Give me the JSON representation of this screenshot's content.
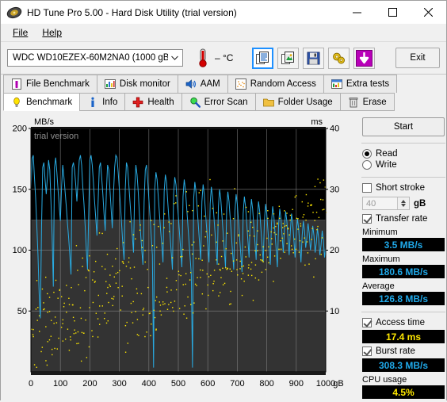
{
  "window": {
    "title": "HD Tune Pro 5.00 - Hard Disk Utility (trial version)",
    "icon": "hard-disk-icon",
    "minimize": "—",
    "maximize": "☐",
    "close": "✕"
  },
  "menu": {
    "items": [
      {
        "label": "File"
      },
      {
        "label": "Help"
      }
    ]
  },
  "toolbar": {
    "drive": "WDC WD10EZEX-60M2NA0 (1000 gB)",
    "chevron": "⌄",
    "temperature": "– °C",
    "buttons": [
      {
        "name": "copy-text-button",
        "icon": "copy-text-icon",
        "selected": true
      },
      {
        "name": "copy-image-button",
        "icon": "copy-image-icon",
        "selected": false
      },
      {
        "name": "save-button",
        "icon": "floppy-save-icon",
        "selected": false
      },
      {
        "name": "options-button",
        "icon": "gears-icon",
        "selected": false
      },
      {
        "name": "download-button",
        "icon": "download-arrow-icon",
        "selected": false
      }
    ],
    "exit_label": "Exit"
  },
  "tabs": {
    "row1": [
      {
        "label": "File Benchmark",
        "icon": "file-benchmark-icon",
        "active": false
      },
      {
        "label": "Disk monitor",
        "icon": "disk-monitor-icon",
        "active": false
      },
      {
        "label": "AAM",
        "icon": "speaker-icon",
        "active": false
      },
      {
        "label": "Random Access",
        "icon": "random-access-icon",
        "active": false
      },
      {
        "label": "Extra tests",
        "icon": "extra-tests-icon",
        "active": false
      }
    ],
    "row2": [
      {
        "label": "Benchmark",
        "icon": "lightbulb-icon",
        "active": true
      },
      {
        "label": "Info",
        "icon": "info-icon",
        "active": false
      },
      {
        "label": "Health",
        "icon": "red-cross-icon",
        "active": false
      },
      {
        "label": "Error Scan",
        "icon": "magnifier-icon",
        "active": false
      },
      {
        "label": "Folder Usage",
        "icon": "folder-icon",
        "active": false
      },
      {
        "label": "Erase",
        "icon": "trash-icon",
        "active": false
      }
    ]
  },
  "panel": {
    "start_label": "Start",
    "mode": {
      "read_label": "Read",
      "write_label": "Write",
      "selected": "Read"
    },
    "short_stroke": {
      "label": "Short stroke",
      "checked": false,
      "value": "40",
      "unit": "gB"
    },
    "transfer_rate": {
      "label": "Transfer rate",
      "checked": true
    },
    "minimum": {
      "label": "Minimum",
      "value": "3.5 MB/s"
    },
    "maximum": {
      "label": "Maximum",
      "value": "180.6 MB/s"
    },
    "average": {
      "label": "Average",
      "value": "126.8 MB/s"
    },
    "access_time": {
      "label": "Access time",
      "checked": true,
      "value": "17.4 ms"
    },
    "burst_rate": {
      "label": "Burst rate",
      "checked": true,
      "value": "308.3 MB/s"
    },
    "cpu_usage": {
      "label": "CPU usage",
      "value": "4.5%"
    }
  },
  "chart_data": {
    "type": "line",
    "title": "",
    "watermark": "trial version",
    "xlabel": "gB",
    "ylabel": "MB/s",
    "y2label": "ms",
    "xlim": [
      0,
      1000
    ],
    "ylim": [
      0,
      200
    ],
    "y2lim": [
      0,
      40
    ],
    "xticks": [
      0,
      100,
      200,
      300,
      400,
      500,
      600,
      700,
      800,
      900,
      1000
    ],
    "yticks": [
      50,
      100,
      150,
      200
    ],
    "y2ticks": [
      10,
      20,
      30,
      40
    ],
    "xtick_labels": [
      "0",
      "100",
      "200",
      "300",
      "400",
      "500",
      "600",
      "700",
      "800",
      "900",
      "1000"
    ],
    "ytick_labels": [
      "50",
      "100",
      "150",
      "200"
    ],
    "y2tick_labels": [
      "10",
      "20",
      "30",
      "40"
    ],
    "x_unit_suffix": "gB",
    "grid": true,
    "legend": "none",
    "colors": {
      "transfer_rate": "#29ABE2",
      "access_time": "#FFE800",
      "plot_bg_top": "#000000",
      "plot_bg_bottom": "#333333",
      "grid": "#8a8a8a"
    },
    "band_split_mbs": 125,
    "series": [
      {
        "name": "Transfer rate",
        "unit": "MB/s",
        "axis": "left",
        "color": "#29ABE2",
        "x": [
          0,
          4,
          8,
          12,
          16,
          20,
          24,
          28,
          32,
          36,
          40,
          44,
          48,
          52,
          56,
          60,
          64,
          68,
          72,
          76,
          80,
          84,
          88,
          92,
          96,
          100,
          104,
          108,
          112,
          116,
          120,
          124,
          128,
          132,
          136,
          140,
          144,
          148,
          152,
          156,
          160,
          164,
          168,
          172,
          176,
          180,
          184,
          188,
          192,
          196,
          200,
          204,
          208,
          212,
          216,
          220,
          224,
          228,
          232,
          236,
          240,
          244,
          248,
          252,
          256,
          260,
          264,
          268,
          272,
          276,
          280,
          284,
          288,
          292,
          296,
          300,
          304,
          308,
          312,
          316,
          320,
          324,
          328,
          332,
          336,
          340,
          344,
          348,
          352,
          356,
          360,
          364,
          368,
          372,
          376,
          380,
          384,
          388,
          392,
          396,
          400,
          404,
          408,
          412,
          416,
          420,
          424,
          428,
          432,
          436,
          440,
          444,
          448,
          452,
          456,
          460,
          464,
          468,
          472,
          476,
          480,
          484,
          488,
          492,
          496,
          500,
          504,
          508,
          512,
          516,
          520,
          524,
          528,
          532,
          536,
          540,
          544,
          548,
          552,
          556,
          560,
          564,
          568,
          572,
          576,
          580,
          584,
          588,
          592,
          596,
          600,
          604,
          608,
          612,
          616,
          620,
          624,
          628,
          632,
          636,
          640,
          644,
          648,
          652,
          656,
          660,
          664,
          668,
          672,
          676,
          680,
          684,
          688,
          692,
          696,
          700,
          704,
          708,
          712,
          716,
          720,
          724,
          728,
          732,
          736,
          740,
          744,
          748,
          752,
          756,
          760,
          764,
          768,
          772,
          776,
          780,
          784,
          788,
          792,
          796,
          800,
          804,
          808,
          812,
          816,
          820,
          824,
          828,
          832,
          836,
          840,
          844,
          848,
          852,
          856,
          860,
          864,
          868,
          872,
          876,
          880,
          884,
          888,
          892,
          896,
          900,
          904,
          908,
          912,
          916,
          920,
          924,
          928,
          932,
          936,
          940,
          944,
          948,
          952,
          956,
          960,
          964,
          968,
          972,
          976,
          980,
          984,
          988,
          992,
          996,
          1000
        ],
        "y": [
          150,
          175,
          178,
          160,
          143,
          120,
          96,
          64,
          44,
          118,
          168,
          172,
          158,
          146,
          160,
          174,
          166,
          140,
          112,
          70,
          168,
          176,
          164,
          150,
          136,
          124,
          152,
          170,
          160,
          148,
          136,
          122,
          110,
          96,
          80,
          168,
          172,
          166,
          154,
          140,
          158,
          174,
          178,
          170,
          152,
          138,
          120,
          100,
          84,
          130,
          174,
          178,
          170,
          156,
          140,
          126,
          112,
          140,
          168,
          172,
          160,
          146,
          130,
          116,
          148,
          170,
          166,
          150,
          134,
          118,
          146,
          168,
          178,
          176,
          164,
          150,
          136,
          120,
          104,
          92,
          150,
          172,
          168,
          154,
          140,
          126,
          112,
          98,
          150,
          170,
          162,
          148,
          130,
          114,
          100,
          88,
          140,
          166,
          170,
          158,
          142,
          128,
          112,
          96,
          3.5,
          150,
          164,
          158,
          144,
          130,
          116,
          104,
          90,
          148,
          162,
          156,
          140,
          126,
          112,
          98,
          84,
          146,
          160,
          154,
          140,
          128,
          114,
          100,
          86,
          144,
          158,
          150,
          136,
          122,
          108,
          94,
          80,
          3.5,
          142,
          156,
          148,
          134,
          120,
          106,
          92,
          140,
          154,
          146,
          132,
          118,
          104,
          90,
          138,
          152,
          144,
          130,
          116,
          102,
          88,
          136,
          150,
          142,
          128,
          114,
          100,
          86,
          134,
          148,
          140,
          126,
          112,
          98,
          84,
          132,
          146,
          138,
          124,
          110,
          96,
          82,
          130,
          144,
          136,
          122,
          108,
          94,
          128,
          142,
          134,
          120,
          106,
          92,
          126,
          140,
          132,
          118,
          104,
          90,
          124,
          138,
          130,
          116,
          102,
          88,
          122,
          136,
          128,
          114,
          100,
          86,
          120,
          134,
          126,
          112,
          98,
          118,
          132,
          124,
          110,
          96,
          116,
          130,
          122,
          108,
          94,
          114,
          126,
          118,
          104,
          90,
          112,
          124,
          116,
          102,
          110,
          122,
          114,
          100,
          108,
          120,
          112,
          98,
          106,
          118,
          110,
          96,
          104,
          116,
          108,
          94,
          102,
          114,
          106,
          92,
          100,
          112,
          104,
          90,
          98,
          110,
          102,
          88,
          96,
          108,
          100,
          86,
          94,
          106,
          98,
          84,
          92,
          104,
          96,
          82,
          90,
          102,
          94,
          80
        ]
      },
      {
        "name": "Access time",
        "unit": "ms",
        "axis": "right",
        "style": "scatter",
        "color": "#FFE800",
        "x": [
          5,
          12,
          18,
          25,
          31,
          38,
          45,
          52,
          58,
          64,
          70,
          77,
          84,
          90,
          97,
          104,
          110,
          116,
          123,
          130,
          136,
          143,
          150,
          156,
          163,
          170,
          176,
          183,
          190,
          196,
          203,
          210,
          216,
          223,
          230,
          236,
          243,
          250,
          256,
          263,
          270,
          276,
          283,
          290,
          296,
          303,
          310,
          316,
          323,
          330,
          336,
          343,
          350,
          356,
          363,
          370,
          376,
          383,
          390,
          396,
          403,
          410,
          416,
          423,
          430,
          436,
          443,
          450,
          456,
          463,
          470,
          476,
          483,
          490,
          496,
          503,
          510,
          516,
          523,
          530,
          536,
          543,
          550,
          556,
          563,
          570,
          576,
          583,
          590,
          596,
          603,
          610,
          616,
          623,
          630,
          636,
          643,
          650,
          656,
          663,
          670,
          676,
          683,
          690,
          696,
          703,
          710,
          716,
          723,
          730,
          736,
          743,
          750,
          756,
          763,
          770,
          776,
          783,
          790,
          796,
          803,
          810,
          816,
          823,
          830,
          836,
          843,
          850,
          856,
          863,
          870,
          876,
          883,
          890,
          896,
          903,
          910,
          916,
          923,
          930,
          936,
          943,
          950,
          956,
          963,
          970,
          976,
          983,
          990,
          996
        ],
        "y": [
          9.2,
          10.1,
          11.3,
          8.8,
          12.4,
          10.6,
          13.2,
          11.0,
          9.6,
          14.1,
          12.0,
          10.8,
          13.6,
          15.2,
          11.6,
          12.8,
          14.4,
          10.4,
          16.0,
          13.0,
          11.8,
          15.6,
          12.6,
          17.1,
          13.8,
          11.4,
          16.4,
          14.8,
          12.2,
          18.0,
          15.0,
          13.4,
          17.6,
          14.0,
          12.9,
          19.2,
          16.2,
          13.6,
          15.8,
          18.4,
          14.6,
          12.4,
          20.1,
          16.8,
          14.2,
          17.2,
          19.6,
          15.4,
          13.1,
          21.0,
          17.4,
          14.9,
          18.8,
          16.0,
          13.7,
          22.4,
          18.2,
          15.6,
          19.4,
          16.6,
          14.3,
          23.1,
          18.9,
          16.1,
          20.2,
          17.0,
          14.8,
          24.0,
          19.6,
          16.8,
          21.1,
          17.6,
          15.2,
          25.2,
          20.4,
          17.4,
          21.8,
          18.2,
          15.8,
          26.1,
          21.0,
          18.0,
          22.6,
          18.8,
          16.2,
          27.0,
          21.6,
          18.6,
          23.2,
          19.4,
          16.8,
          28.2,
          22.2,
          19.2,
          24.0,
          20.0,
          17.2,
          29.0,
          22.8,
          19.8,
          24.6,
          20.6,
          17.8,
          30.1,
          23.4,
          20.4,
          25.2,
          21.2,
          18.4,
          31.0,
          24.0,
          21.0,
          25.8,
          21.8,
          19.0,
          26.4,
          22.4,
          19.6,
          27.0,
          23.0,
          20.2,
          27.6,
          23.6,
          20.8,
          28.2,
          24.2,
          21.4,
          28.8,
          24.8,
          22.0,
          29.4,
          25.4,
          22.6,
          30.0,
          26.0,
          23.2,
          30.6,
          26.6,
          23.8,
          31.2,
          27.2,
          24.4,
          31.8,
          27.8,
          25.0,
          32.4,
          28.4,
          25.6,
          33.0,
          29.0,
          26.2,
          22.8
        ]
      }
    ]
  }
}
